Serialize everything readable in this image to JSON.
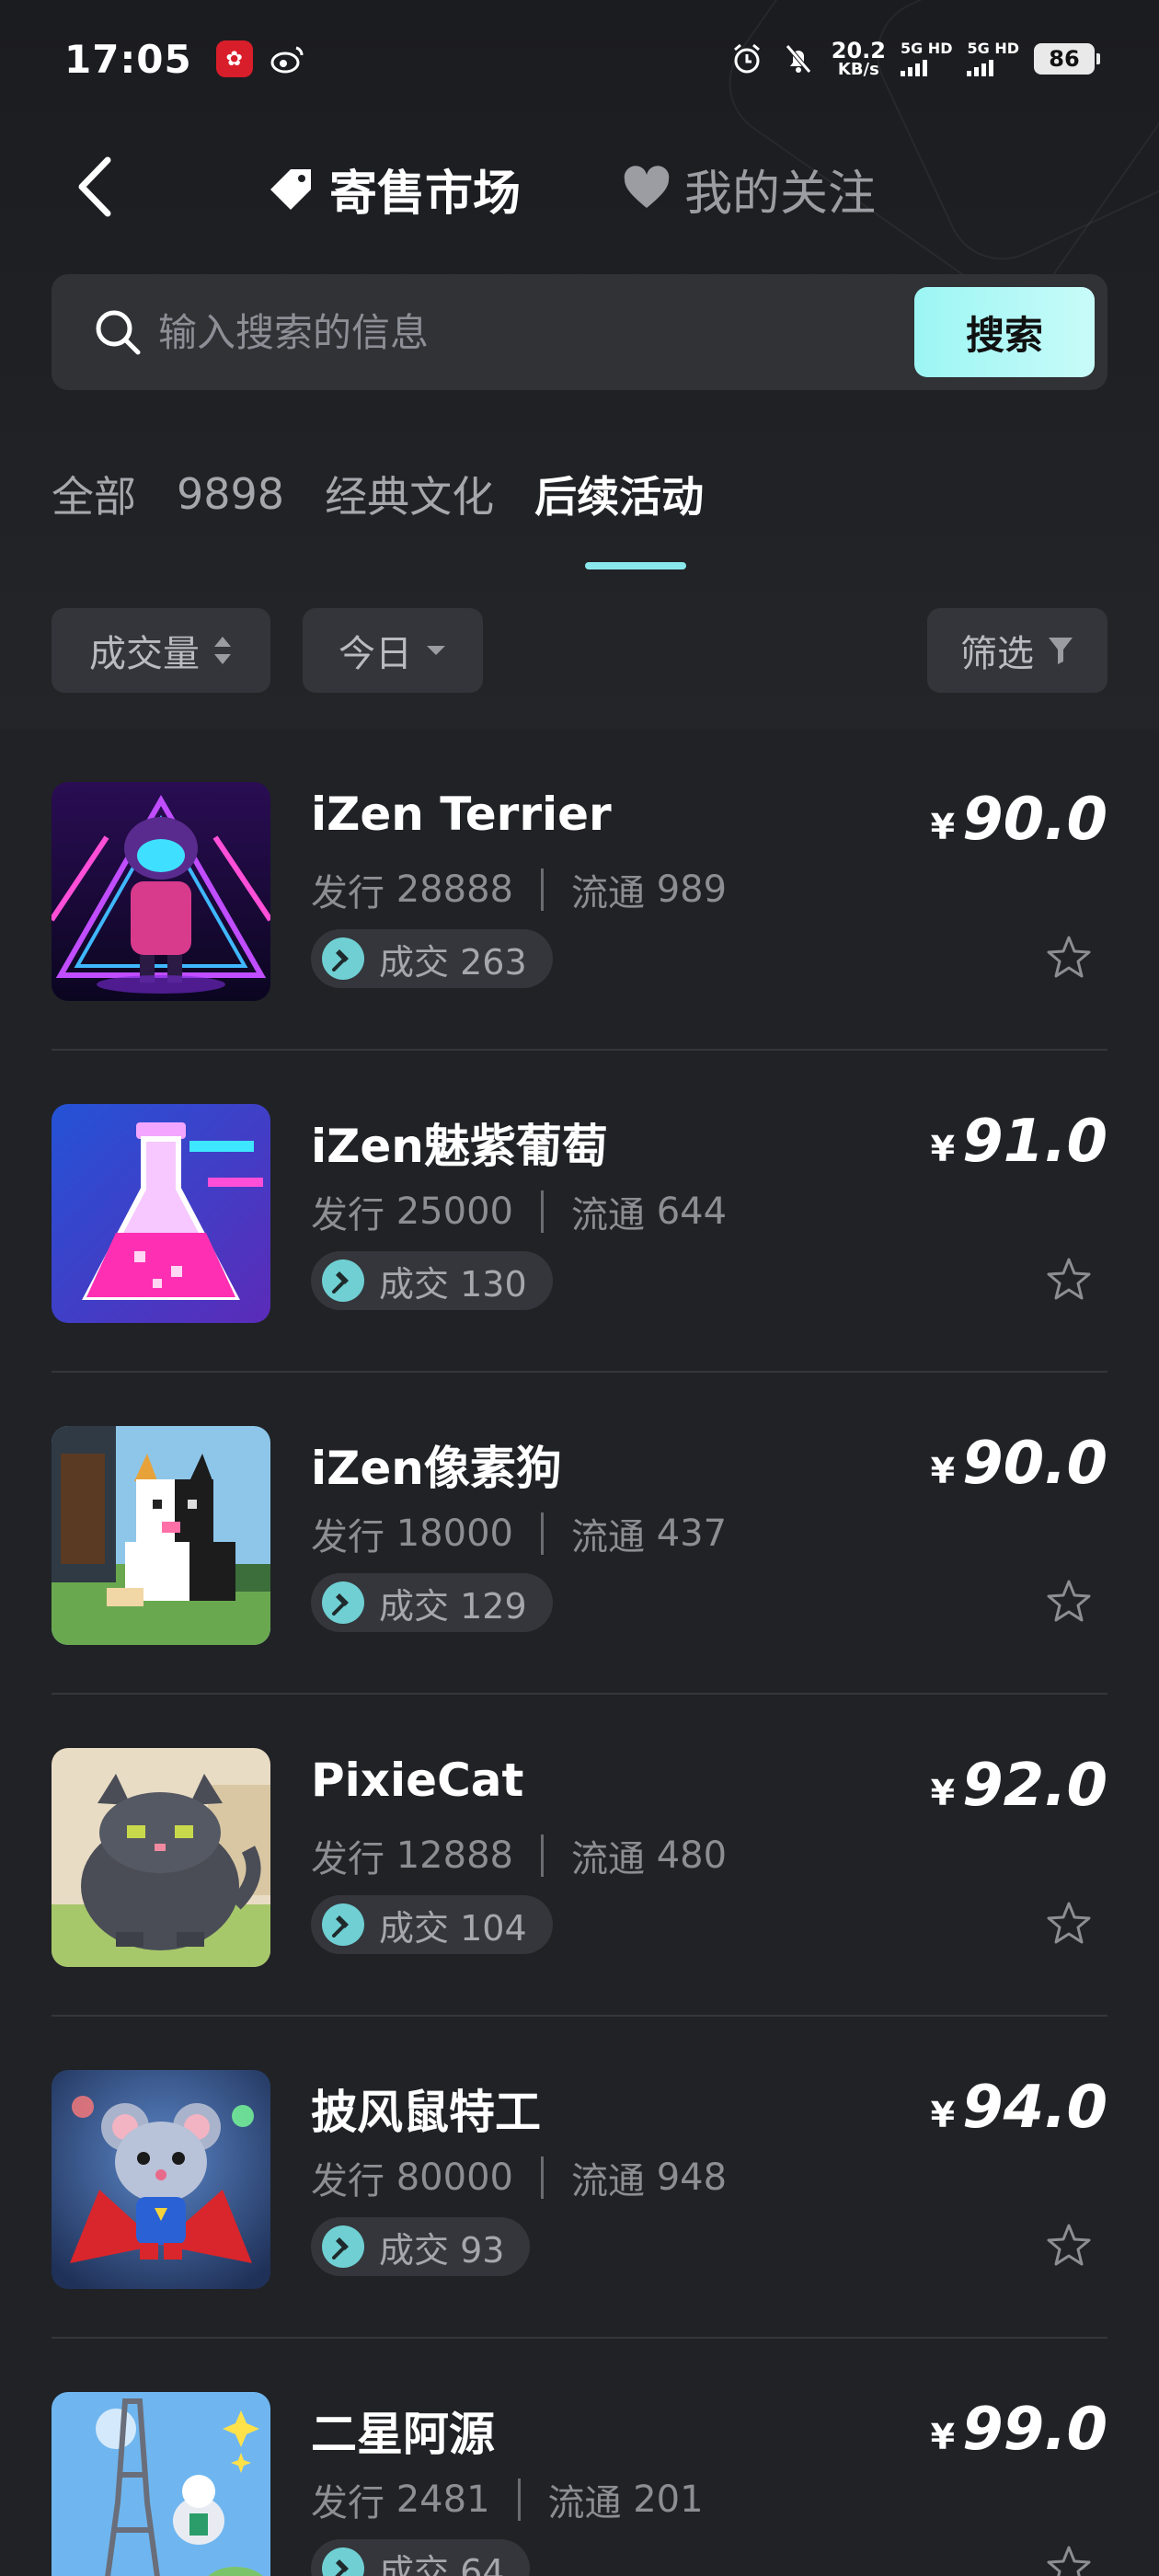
{
  "status_bar": {
    "time": "17:05",
    "net_speed_value": "20.2",
    "net_speed_unit": "KB/s",
    "sim1_label": "5G HD",
    "sim2_label": "5G HD",
    "battery": "86"
  },
  "nav": {
    "tab_market": "寄售市场",
    "tab_follow": "我的关注"
  },
  "search": {
    "placeholder": "输入搜索的信息",
    "value": "",
    "button_label": "搜索"
  },
  "categories": [
    "全部",
    "9898",
    "经典文化",
    "后续活动"
  ],
  "active_category": "后续活动",
  "filters": {
    "sort_label": "成交量",
    "period_label": "今日",
    "filter_label": "筛选"
  },
  "labels": {
    "issue": "发行",
    "circulation": "流通",
    "deals": "成交",
    "currency": "¥"
  },
  "items": [
    {
      "name": "iZen Terrier",
      "issue": "28888",
      "circulation": "989",
      "deals": "263",
      "price": "90.0"
    },
    {
      "name": "iZen魅紫葡萄",
      "issue": "25000",
      "circulation": "644",
      "deals": "130",
      "price": "91.0"
    },
    {
      "name": "iZen像素狗",
      "issue": "18000",
      "circulation": "437",
      "deals": "129",
      "price": "90.0"
    },
    {
      "name": "PixieCat",
      "issue": "12888",
      "circulation": "480",
      "deals": "104",
      "price": "92.0"
    },
    {
      "name": "披风鼠特工",
      "issue": "80000",
      "circulation": "948",
      "deals": "93",
      "price": "94.0"
    },
    {
      "name": "二星阿源",
      "issue": "2481",
      "circulation": "201",
      "deals": "64",
      "price": "99.0"
    }
  ],
  "colors": {
    "accent": "#8ae8ec",
    "search_button": "#b6f8f6",
    "background": "#202226"
  }
}
